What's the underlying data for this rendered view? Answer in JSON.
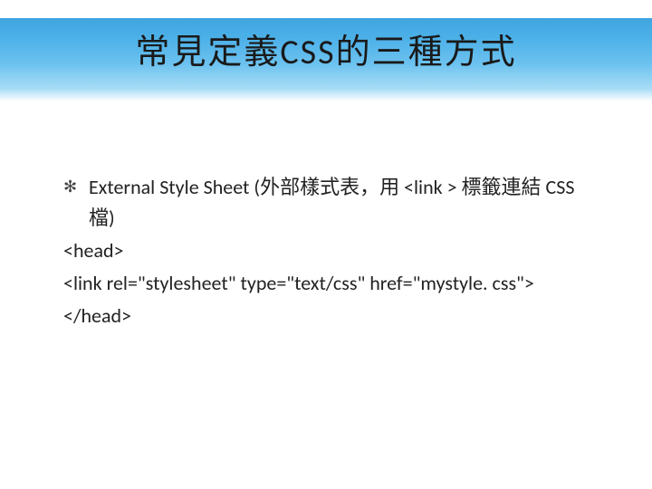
{
  "title": "常見定義CSS的三種方式",
  "body": {
    "bullet": "External Style Sheet (外部樣式表，用 <link > 標籤連結 CSS 檔)",
    "line1": "<head>",
    "line2": "<link rel=\"stylesheet\" type=\"text/css\" href=\"mystyle. css\">",
    "line3": "</head>"
  }
}
